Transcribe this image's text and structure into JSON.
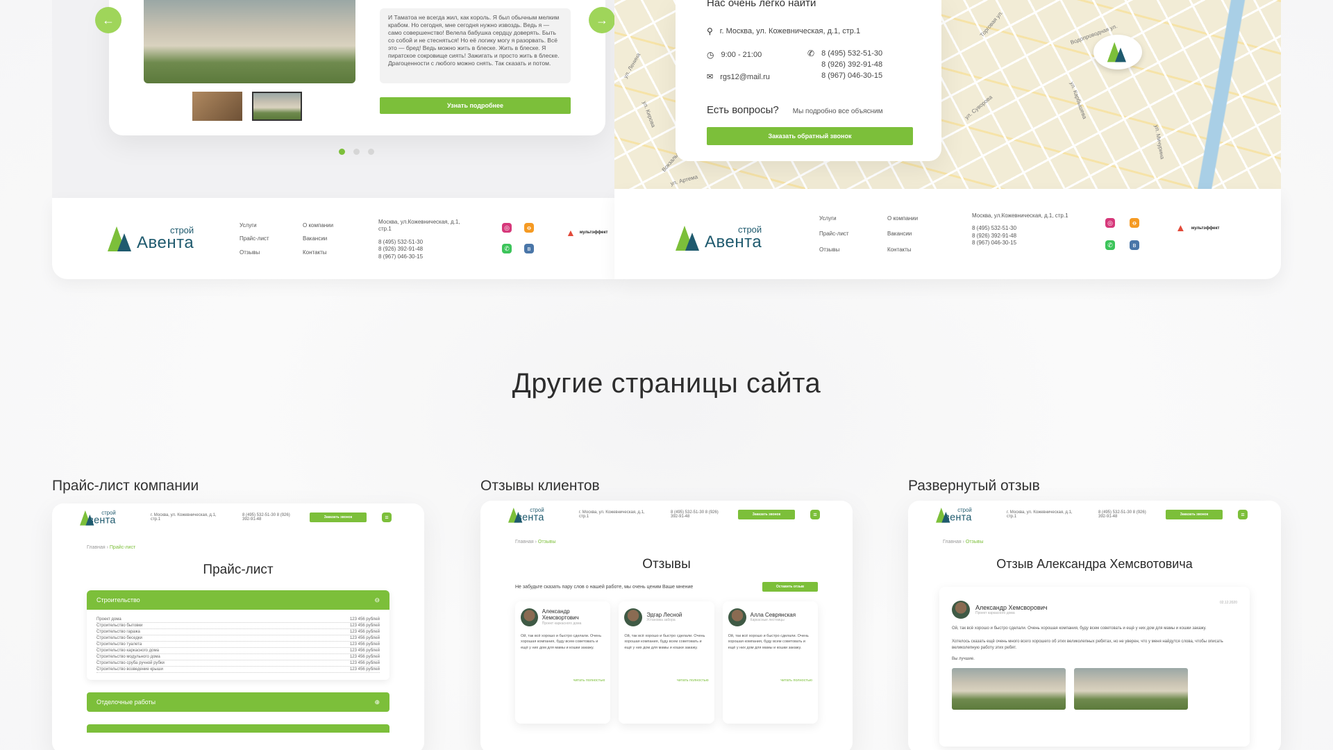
{
  "slider": {
    "text": "И Таматоа не всегда жил, как король. Я был обычным мелким крабом. Но сегодня, мне сегодня нужно извоздь. Ведь я — само совершенство! Велела бабушка сердцу доверять. Быть со собой и не стесняться! Но её логику могу я разорвать. Всё это — бред! Ведь можно жить в блеске. Жить в блеске. Я пиратское сокровище сиять! Зажигать и просто жить в блеске. Драгоценности с любого можно снять. Так сказать и потом.",
    "more_button": "Узнать подробнее",
    "prev_arrow": "←",
    "next_arrow": "→"
  },
  "contacts": {
    "heading": "Нас очень легко найти",
    "address": "г. Москва, ул. Кожевническая, д.1, стр.1",
    "hours": "9:00 - 21:00",
    "phones": [
      "8 (495) 532-51-30",
      "8 (926) 392-91-48",
      "8 (967) 046-30-15"
    ],
    "email": "rgs12@mail.ru",
    "question": "Есть вопросы?",
    "question_note": "Мы подробно все объясним",
    "callback_button": "Заказать обратный звонок"
  },
  "map_labels": [
    "ул. Суворова",
    "Торговая ул.",
    "Водопроводная ул.",
    "ул. Ленина",
    "ул. Карбышева",
    "ул. Мичурина",
    "ул. Кирова",
    "Вокзальная ул.",
    "ул. Артема"
  ],
  "footer": {
    "logo_small": "строй",
    "logo_big": "Авента",
    "col1": [
      "Услуги",
      "Прайс-лист",
      "Отзывы"
    ],
    "col2": [
      "О компании",
      "Вакансии",
      "Контакты"
    ],
    "address": "Москва, ул.Кожевническая, д.1, стр.1",
    "phones": [
      "8 (495) 532-51-30",
      "8 (926) 392-91-48",
      "8 (967) 046-30-15"
    ],
    "dev": "мультэффект"
  },
  "section_title": "Другие страницы сайта",
  "pages": {
    "price": {
      "caption": "Прайс-лист компании",
      "breadcrumb_home": "Главная",
      "breadcrumb_current": "Прайс-лист",
      "title": "Прайс-лист",
      "accordion1": "Строительство",
      "accordion2": "Отделочные работы",
      "rows": [
        {
          "name": "Проект дома",
          "price": "123 456 рублей"
        },
        {
          "name": "Строительство бытовки",
          "price": "123 456 рублей"
        },
        {
          "name": "Строительство гаража",
          "price": "123 456 рублей"
        },
        {
          "name": "Строительство беседки",
          "price": "123 456 рублей"
        },
        {
          "name": "Строительство туалета",
          "price": "123 456 рублей"
        },
        {
          "name": "Строительство каркасного дома",
          "price": "123 456 рублей"
        },
        {
          "name": "Строительство модульного дома",
          "price": "123 456 рублей"
        },
        {
          "name": "Строительство сруба ручной рубки",
          "price": "123 456 рублей"
        },
        {
          "name": "Строительство возведение крыши",
          "price": "123 456 рублей"
        }
      ]
    },
    "reviews": {
      "caption": "Отзывы клиентов",
      "breadcrumb_home": "Главная",
      "breadcrumb_current": "Отзывы",
      "title": "Отзывы",
      "intro": "Не забудьте сказать пару слов о нашей работе, мы очень ценим Ваше мнение",
      "leave_button": "Оставить отзыв",
      "people": [
        {
          "name": "Александр Хемсвортович",
          "role": "Проект каркасного дома"
        },
        {
          "name": "Эдгар Лесной",
          "role": "Установка забора"
        },
        {
          "name": "Алла Севрянская",
          "role": "Каркасные лестницы"
        }
      ],
      "body": "Ой, так всё хорошо и быстро сделали. Очень хорошая компания, буду всем советовать и ещё у них дом для мамы и кошки закажу.",
      "more": "читать полностью"
    },
    "full_review": {
      "caption": "Развернутый отзыв",
      "breadcrumb_home": "Главная",
      "breadcrumb_current": "Отзывы",
      "title": "Отзыв Александра Хемсвотовича",
      "name": "Александр Хемсворович",
      "role": "Проект каркасного дома",
      "date": "02.12.2020",
      "text1": "Ой, так всё хорошо и быстро сделали. Очень хорошая компания, буду всем советовать и ещё у них дом для мамы и кошки закажу.",
      "text2": "Хотелось сказать ещё очень много всего хорошего об этих великолепных ребятах, но не уверен, что у меня найдутся слова, чтобы описать великолепную работу этих ребят.",
      "sign": "Вы лучшие."
    },
    "mini_header": {
      "address": "г. Москва, ул. Кожевническая, д.1, стр.1",
      "phones": "8 (495) 532-51-30 8 (926) 392-91-48",
      "call_button": "Заказать звонок"
    }
  },
  "colors": {
    "accent": "#7cbf3a",
    "brand_dark": "#1f5a6e"
  }
}
